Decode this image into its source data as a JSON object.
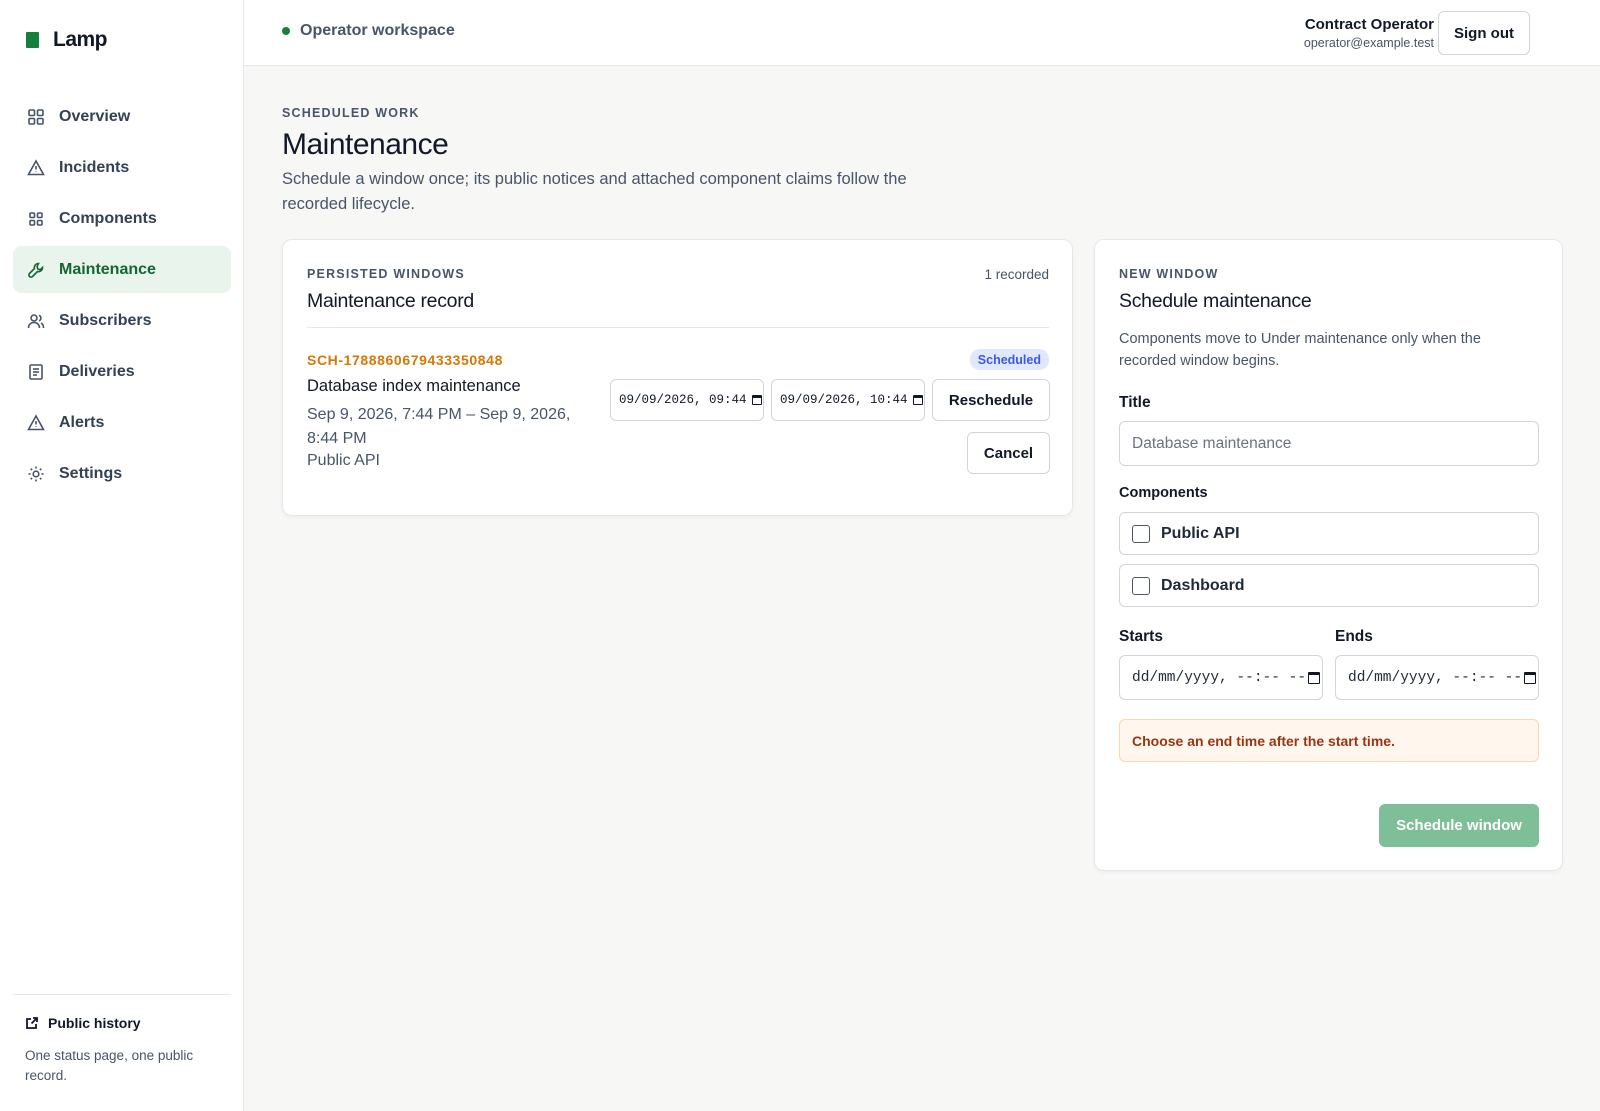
{
  "brand": {
    "name": "Lamp",
    "accent": "#15803d"
  },
  "sidebar": {
    "items": [
      {
        "label": "Overview",
        "icon": "grid-icon",
        "active": false
      },
      {
        "label": "Incidents",
        "icon": "warning-icon",
        "active": false
      },
      {
        "label": "Components",
        "icon": "components-icon",
        "active": false
      },
      {
        "label": "Maintenance",
        "icon": "wrench-icon",
        "active": true
      },
      {
        "label": "Subscribers",
        "icon": "users-icon",
        "active": false
      },
      {
        "label": "Deliveries",
        "icon": "document-icon",
        "active": false
      },
      {
        "label": "Alerts",
        "icon": "warning-icon",
        "active": false
      },
      {
        "label": "Settings",
        "icon": "gear-icon",
        "active": false
      }
    ],
    "footer": {
      "link": "Public history",
      "note": "One status page, one public record."
    }
  },
  "topbar": {
    "workspace": "Operator workspace",
    "user_name": "Contract Operator",
    "user_email": "operator@example.test",
    "signout": "Sign out"
  },
  "page": {
    "eyebrow": "Scheduled work",
    "title": "Maintenance",
    "description": "Schedule a window once; its public notices and attached component claims follow the recorded lifecycle."
  },
  "records": {
    "eyebrow": "Persisted windows",
    "title": "Maintenance record",
    "count": "1 recorded",
    "items": [
      {
        "id": "SCH-1788860679433350848",
        "status": "Scheduled",
        "title": "Database index maintenance",
        "range": "Sep 9, 2026, 7:44 PM – Sep 9, 2026, 8:44 PM",
        "component": "Public API",
        "start_input": "09/09/2026, 09:44",
        "end_input": "09/09/2026, 10:44",
        "reschedule": "Reschedule",
        "cancel": "Cancel"
      }
    ]
  },
  "form": {
    "eyebrow": "New window",
    "title": "Schedule maintenance",
    "description": "Components move to Under maintenance only when the recorded window begins.",
    "title_label": "Title",
    "title_placeholder": "Database maintenance",
    "components_label": "Components",
    "components": [
      {
        "label": "Public API",
        "checked": false
      },
      {
        "label": "Dashboard",
        "checked": false
      }
    ],
    "starts_label": "Starts",
    "ends_label": "Ends",
    "starts_value": "dd/mm/yyyy, --:-- --",
    "ends_value": "dd/mm/yyyy, --:-- --",
    "error": "Choose an end time after the start time.",
    "submit": "Schedule window"
  }
}
